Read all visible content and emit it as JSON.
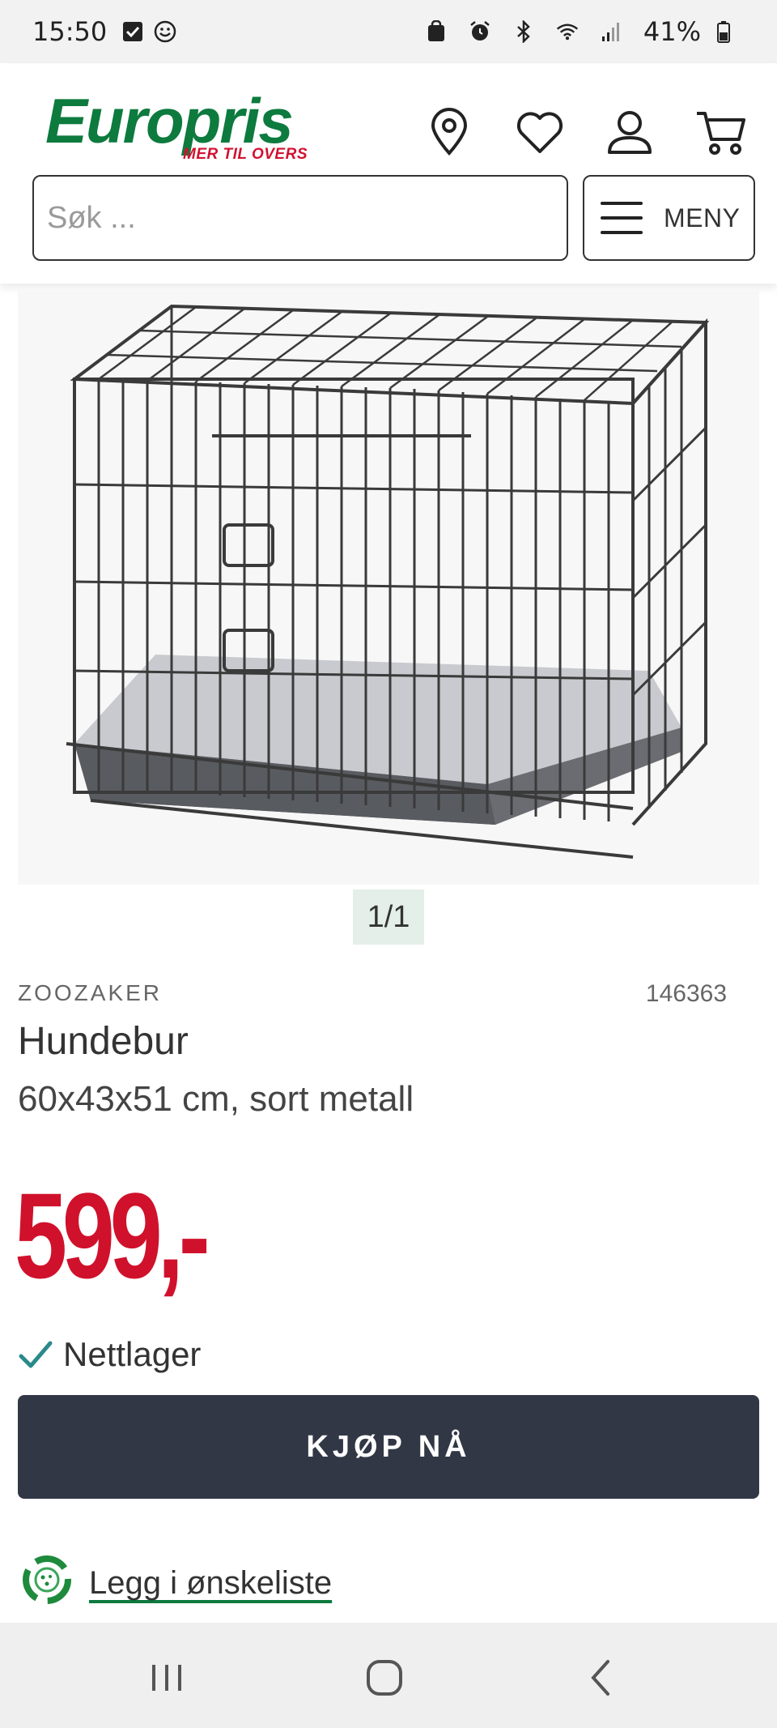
{
  "status_bar": {
    "time": "15:50",
    "battery": "41%",
    "left_icons": [
      "checkbox-icon",
      "smiley-icon"
    ],
    "right_icons": [
      "nfc-icon",
      "alarm-icon",
      "bluetooth-icon",
      "wifi-icon",
      "signal-icon",
      "battery-icon"
    ]
  },
  "header": {
    "logo_text": "Europris",
    "logo_tagline": "MER TIL OVERS",
    "icons": [
      "location-pin-icon",
      "heart-icon",
      "user-icon",
      "cart-icon"
    ],
    "search_placeholder": "Søk ...",
    "menu_label": "MENY"
  },
  "gallery": {
    "counter": "1/1"
  },
  "product": {
    "brand": "ZOOZAKER",
    "sku": "146363",
    "name": "Hundebur",
    "description": "60x43x51 cm, sort metall",
    "price": "599,-",
    "stock_label": "Nettlager",
    "buy_label": "KJØP NÅ",
    "wishlist_label": "Legg i ønskeliste"
  },
  "colors": {
    "brand_green": "#0d7a3e",
    "price_red": "#d0112b",
    "button_dark": "#323745",
    "check_teal": "#2a8a8a"
  }
}
